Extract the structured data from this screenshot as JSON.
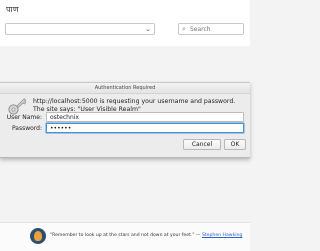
{
  "site": {
    "title": "पाण"
  },
  "search": {
    "category_label": "",
    "placeholder": "Search"
  },
  "dialog": {
    "title": "Authentication Required",
    "message": "http://localhost:5000 is requesting your username and password. The site says: \"User Visible Realm\"",
    "username_label": "User Name:",
    "username_value": "ostechnix",
    "password_label": "Password:",
    "password_value": "••••••",
    "cancel_label": "Cancel",
    "ok_label": "OK"
  },
  "footer": {
    "quote": "\"Remember to look up at the stars and not down at your feet.\" — ",
    "author": "Stephen Hawking"
  },
  "icons": {
    "dialog": "key-icon",
    "footer": "site-logo-icon",
    "search": "search-icon",
    "dropdown": "chevron-down-icon"
  }
}
